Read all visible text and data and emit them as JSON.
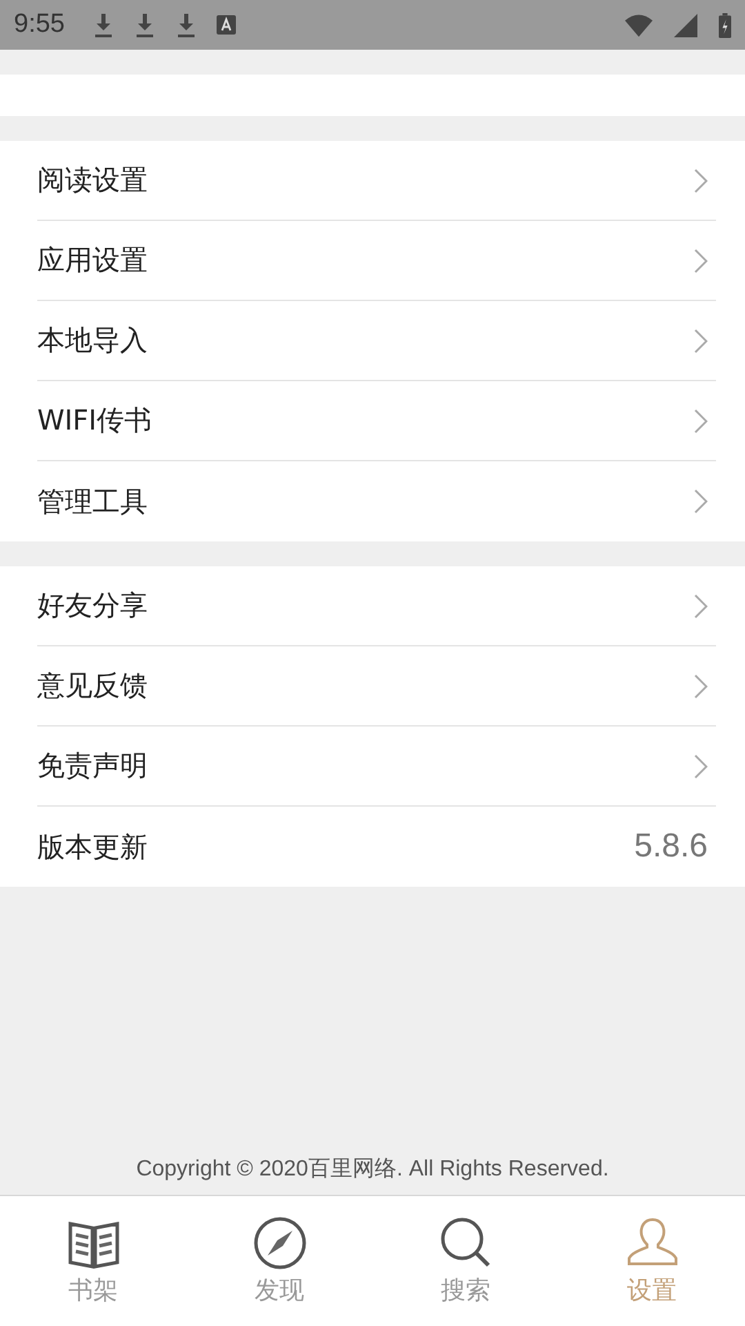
{
  "status_bar": {
    "time": "9:55"
  },
  "groups": [
    {
      "items": [
        {
          "kind": "link",
          "label": "阅读设置"
        },
        {
          "kind": "link",
          "label": "应用设置"
        },
        {
          "kind": "link",
          "label": "本地导入"
        },
        {
          "kind": "link",
          "label": "WIFI传书"
        },
        {
          "kind": "link",
          "label": "管理工具"
        }
      ]
    },
    {
      "items": [
        {
          "kind": "link",
          "label": "好友分享"
        },
        {
          "kind": "link",
          "label": "意见反馈"
        },
        {
          "kind": "link",
          "label": "免责声明"
        },
        {
          "kind": "value",
          "label": "版本更新",
          "value": "5.8.6"
        }
      ]
    }
  ],
  "copyright": "Copyright © 2020百里网络. All Rights Reserved.",
  "tabs": [
    {
      "kind": "book",
      "label": "书架",
      "selected": false
    },
    {
      "kind": "compass",
      "label": "发现",
      "selected": false
    },
    {
      "kind": "search",
      "label": "搜索",
      "selected": false
    },
    {
      "kind": "person",
      "label": "设置",
      "selected": true
    }
  ]
}
